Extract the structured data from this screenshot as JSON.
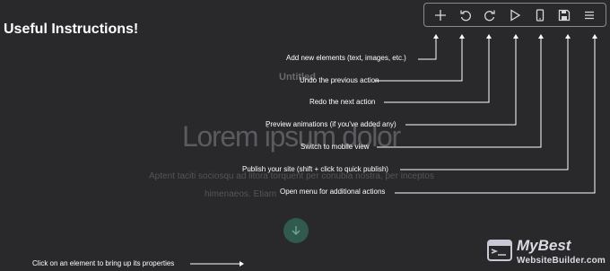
{
  "heading": "Useful Instructions!",
  "toolbar": {
    "buttons": [
      {
        "icon": "plus-icon"
      },
      {
        "icon": "undo-icon"
      },
      {
        "icon": "redo-icon"
      },
      {
        "icon": "play-icon"
      },
      {
        "icon": "mobile-icon"
      },
      {
        "icon": "save-icon"
      },
      {
        "icon": "menu-icon"
      }
    ]
  },
  "background": {
    "untitled": "Untitled",
    "lorem": "Lorem ipsum dolor",
    "body_line1": "Aptent taciti sociosqu ad litora torquent per conubia nostra, per inceptos",
    "body_line2": "himenaeos. Etiam"
  },
  "instructions": {
    "add": "Add new elements (text, images, etc.)",
    "undo": "Undo the previous action",
    "redo": "Redo the next action",
    "preview": "Preview animations (if you've added any)",
    "mobile": "Switch to mobile view",
    "publish": "Publish your site (shift + click to quick publish)",
    "menu": "Open menu for additional actions",
    "click": "Click on an element to bring up its properties"
  },
  "logo": {
    "line1": "MyBest",
    "line2": "WebsiteBuilder.com"
  },
  "colors": {
    "background": "#29282b",
    "text": "#ffffff",
    "accent_circle": "#2f5a4d"
  }
}
